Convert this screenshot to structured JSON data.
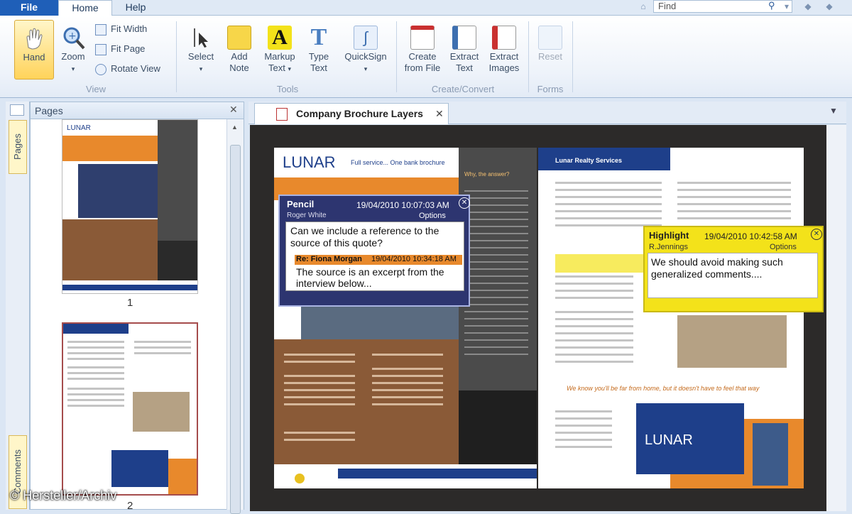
{
  "tabs": {
    "file": "File",
    "home": "Home",
    "help": "Help"
  },
  "find": {
    "placeholder": "Find"
  },
  "ribbon": {
    "hand": "Hand",
    "zoom": "Zoom",
    "fit_width": "Fit Width",
    "fit_page": "Fit Page",
    "rotate_view": "Rotate View",
    "view_group": "View",
    "select": "Select",
    "add_note": "Add Note",
    "markup_text": "Markup Text",
    "type_text": "Type Text",
    "quicksign": "QuickSign",
    "tools_group": "Tools",
    "create_from_file": "Create from File",
    "extract_text": "Extract Text",
    "extract_images": "Extract Images",
    "create_group": "Create/Convert",
    "reset": "Reset",
    "forms_group": "Forms"
  },
  "side_tabs": {
    "pages": "Pages",
    "comments": "Comments"
  },
  "pages_panel": {
    "title": "Pages",
    "page1": "1",
    "page2": "2"
  },
  "document": {
    "tab_title": "Company Brochure Layers"
  },
  "brochure": {
    "logo": "LUNAR",
    "tagline": "Full service... One bank brochure",
    "right_header": "Lunar Realty Services",
    "why_heading": "Why, the answer?",
    "center_quote": "We know you'll be far from home, but it doesn't have to feel that way"
  },
  "pencil_note": {
    "type": "Pencil",
    "date": "19/04/2010 10:07:03 AM",
    "author": "Roger White",
    "options": "Options",
    "text": "Can we include a reference to the source of this quote?",
    "reply_header": "Re: Fiona Morgan",
    "reply_date": "19/04/2010 10:34:18 AM",
    "reply_text": "The source is an excerpt from the interview below..."
  },
  "highlight_note": {
    "type": "Highlight",
    "date": "19/04/2010 10:42:58 AM",
    "author": "R.Jennings",
    "options": "Options",
    "text": "We should avoid making such generalized comments...."
  },
  "copyright": "© Hersteller/Archiv"
}
